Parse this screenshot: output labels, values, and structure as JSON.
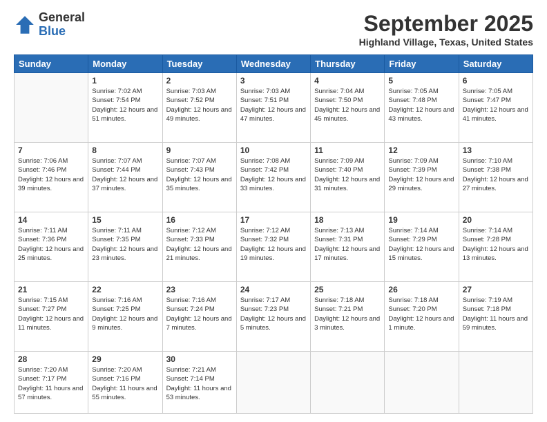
{
  "logo": {
    "general": "General",
    "blue": "Blue"
  },
  "title": "September 2025",
  "location": "Highland Village, Texas, United States",
  "days_header": [
    "Sunday",
    "Monday",
    "Tuesday",
    "Wednesday",
    "Thursday",
    "Friday",
    "Saturday"
  ],
  "weeks": [
    [
      {
        "day": "",
        "sunrise": "",
        "sunset": "",
        "daylight": ""
      },
      {
        "day": "1",
        "sunrise": "Sunrise: 7:02 AM",
        "sunset": "Sunset: 7:54 PM",
        "daylight": "Daylight: 12 hours and 51 minutes."
      },
      {
        "day": "2",
        "sunrise": "Sunrise: 7:03 AM",
        "sunset": "Sunset: 7:52 PM",
        "daylight": "Daylight: 12 hours and 49 minutes."
      },
      {
        "day": "3",
        "sunrise": "Sunrise: 7:03 AM",
        "sunset": "Sunset: 7:51 PM",
        "daylight": "Daylight: 12 hours and 47 minutes."
      },
      {
        "day": "4",
        "sunrise": "Sunrise: 7:04 AM",
        "sunset": "Sunset: 7:50 PM",
        "daylight": "Daylight: 12 hours and 45 minutes."
      },
      {
        "day": "5",
        "sunrise": "Sunrise: 7:05 AM",
        "sunset": "Sunset: 7:48 PM",
        "daylight": "Daylight: 12 hours and 43 minutes."
      },
      {
        "day": "6",
        "sunrise": "Sunrise: 7:05 AM",
        "sunset": "Sunset: 7:47 PM",
        "daylight": "Daylight: 12 hours and 41 minutes."
      }
    ],
    [
      {
        "day": "7",
        "sunrise": "Sunrise: 7:06 AM",
        "sunset": "Sunset: 7:46 PM",
        "daylight": "Daylight: 12 hours and 39 minutes."
      },
      {
        "day": "8",
        "sunrise": "Sunrise: 7:07 AM",
        "sunset": "Sunset: 7:44 PM",
        "daylight": "Daylight: 12 hours and 37 minutes."
      },
      {
        "day": "9",
        "sunrise": "Sunrise: 7:07 AM",
        "sunset": "Sunset: 7:43 PM",
        "daylight": "Daylight: 12 hours and 35 minutes."
      },
      {
        "day": "10",
        "sunrise": "Sunrise: 7:08 AM",
        "sunset": "Sunset: 7:42 PM",
        "daylight": "Daylight: 12 hours and 33 minutes."
      },
      {
        "day": "11",
        "sunrise": "Sunrise: 7:09 AM",
        "sunset": "Sunset: 7:40 PM",
        "daylight": "Daylight: 12 hours and 31 minutes."
      },
      {
        "day": "12",
        "sunrise": "Sunrise: 7:09 AM",
        "sunset": "Sunset: 7:39 PM",
        "daylight": "Daylight: 12 hours and 29 minutes."
      },
      {
        "day": "13",
        "sunrise": "Sunrise: 7:10 AM",
        "sunset": "Sunset: 7:38 PM",
        "daylight": "Daylight: 12 hours and 27 minutes."
      }
    ],
    [
      {
        "day": "14",
        "sunrise": "Sunrise: 7:11 AM",
        "sunset": "Sunset: 7:36 PM",
        "daylight": "Daylight: 12 hours and 25 minutes."
      },
      {
        "day": "15",
        "sunrise": "Sunrise: 7:11 AM",
        "sunset": "Sunset: 7:35 PM",
        "daylight": "Daylight: 12 hours and 23 minutes."
      },
      {
        "day": "16",
        "sunrise": "Sunrise: 7:12 AM",
        "sunset": "Sunset: 7:33 PM",
        "daylight": "Daylight: 12 hours and 21 minutes."
      },
      {
        "day": "17",
        "sunrise": "Sunrise: 7:12 AM",
        "sunset": "Sunset: 7:32 PM",
        "daylight": "Daylight: 12 hours and 19 minutes."
      },
      {
        "day": "18",
        "sunrise": "Sunrise: 7:13 AM",
        "sunset": "Sunset: 7:31 PM",
        "daylight": "Daylight: 12 hours and 17 minutes."
      },
      {
        "day": "19",
        "sunrise": "Sunrise: 7:14 AM",
        "sunset": "Sunset: 7:29 PM",
        "daylight": "Daylight: 12 hours and 15 minutes."
      },
      {
        "day": "20",
        "sunrise": "Sunrise: 7:14 AM",
        "sunset": "Sunset: 7:28 PM",
        "daylight": "Daylight: 12 hours and 13 minutes."
      }
    ],
    [
      {
        "day": "21",
        "sunrise": "Sunrise: 7:15 AM",
        "sunset": "Sunset: 7:27 PM",
        "daylight": "Daylight: 12 hours and 11 minutes."
      },
      {
        "day": "22",
        "sunrise": "Sunrise: 7:16 AM",
        "sunset": "Sunset: 7:25 PM",
        "daylight": "Daylight: 12 hours and 9 minutes."
      },
      {
        "day": "23",
        "sunrise": "Sunrise: 7:16 AM",
        "sunset": "Sunset: 7:24 PM",
        "daylight": "Daylight: 12 hours and 7 minutes."
      },
      {
        "day": "24",
        "sunrise": "Sunrise: 7:17 AM",
        "sunset": "Sunset: 7:23 PM",
        "daylight": "Daylight: 12 hours and 5 minutes."
      },
      {
        "day": "25",
        "sunrise": "Sunrise: 7:18 AM",
        "sunset": "Sunset: 7:21 PM",
        "daylight": "Daylight: 12 hours and 3 minutes."
      },
      {
        "day": "26",
        "sunrise": "Sunrise: 7:18 AM",
        "sunset": "Sunset: 7:20 PM",
        "daylight": "Daylight: 12 hours and 1 minute."
      },
      {
        "day": "27",
        "sunrise": "Sunrise: 7:19 AM",
        "sunset": "Sunset: 7:18 PM",
        "daylight": "Daylight: 11 hours and 59 minutes."
      }
    ],
    [
      {
        "day": "28",
        "sunrise": "Sunrise: 7:20 AM",
        "sunset": "Sunset: 7:17 PM",
        "daylight": "Daylight: 11 hours and 57 minutes."
      },
      {
        "day": "29",
        "sunrise": "Sunrise: 7:20 AM",
        "sunset": "Sunset: 7:16 PM",
        "daylight": "Daylight: 11 hours and 55 minutes."
      },
      {
        "day": "30",
        "sunrise": "Sunrise: 7:21 AM",
        "sunset": "Sunset: 7:14 PM",
        "daylight": "Daylight: 11 hours and 53 minutes."
      },
      {
        "day": "",
        "sunrise": "",
        "sunset": "",
        "daylight": ""
      },
      {
        "day": "",
        "sunrise": "",
        "sunset": "",
        "daylight": ""
      },
      {
        "day": "",
        "sunrise": "",
        "sunset": "",
        "daylight": ""
      },
      {
        "day": "",
        "sunrise": "",
        "sunset": "",
        "daylight": ""
      }
    ]
  ]
}
